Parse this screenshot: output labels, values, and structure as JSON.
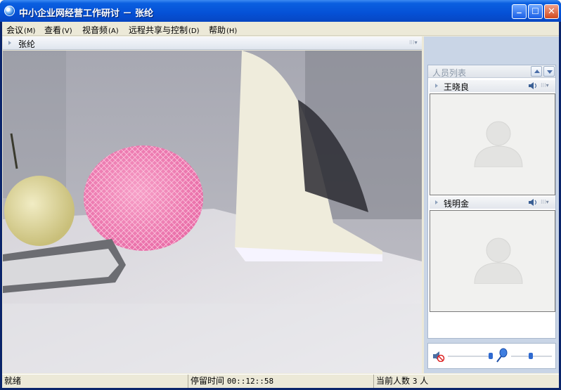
{
  "window": {
    "title": "中小企业网经营工作研讨 － 张纶"
  },
  "menu": {
    "items": [
      {
        "label": "会议",
        "key": "(M)"
      },
      {
        "label": "查看",
        "key": "(V)"
      },
      {
        "label": "视音频",
        "key": "(A)"
      },
      {
        "label": "远程共享与控制",
        "key": "(D)"
      },
      {
        "label": "帮助",
        "key": "(H)"
      }
    ]
  },
  "video_panel": {
    "title": "张纶"
  },
  "participants": {
    "title": "人员列表",
    "members": [
      {
        "name": "王晓良"
      },
      {
        "name": "钱明金"
      }
    ]
  },
  "status": {
    "ready": "就绪",
    "stay_label": "停留时间",
    "stay_time": "00::12::58",
    "count_label": "当前人数",
    "count": "3",
    "count_unit": "人"
  },
  "colors": {
    "titlebar": "#0551d6",
    "frame": "#ece9d8",
    "panel": "#c9d5e6"
  }
}
